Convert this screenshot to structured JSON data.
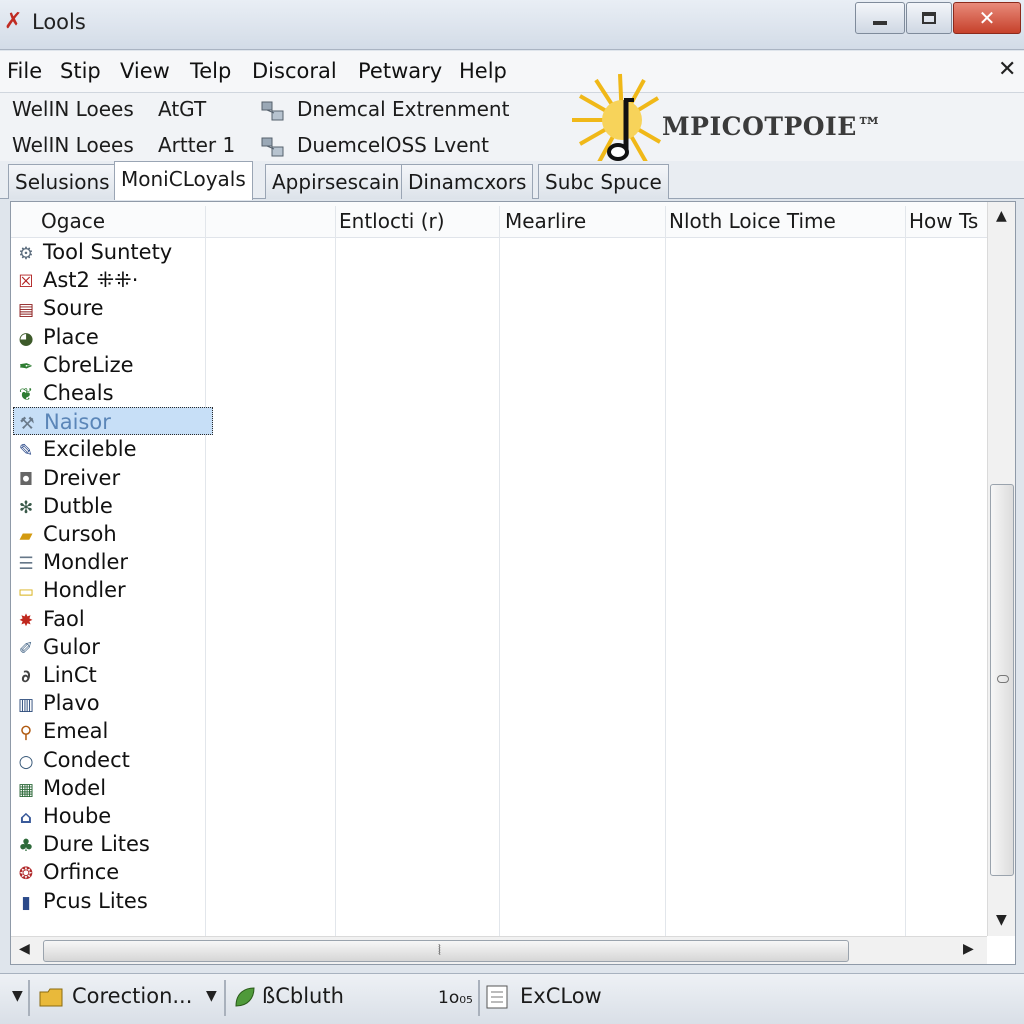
{
  "window": {
    "title": "Lools"
  },
  "menu": [
    "File",
    "Stip",
    "View",
    "Telp",
    "Discoral",
    "Petwary",
    "Help"
  ],
  "toolbar": {
    "row1": {
      "label": "WelIN Loees",
      "value": "AtGT",
      "button": "Dnemcal Extrenment"
    },
    "row2": {
      "label": "WelIN Loees",
      "value": "Artter 1",
      "button": "DuemcelOSS Lvent"
    }
  },
  "logo": {
    "text": "MPICOTPOIE™"
  },
  "tabs": [
    {
      "label": "Selusions",
      "active": false
    },
    {
      "label": "MoniCLoyals",
      "active": true
    },
    {
      "label": "Appirsescain",
      "active": false
    },
    {
      "label": "Dinamcxors",
      "active": false
    },
    {
      "label": "Subc Spuce",
      "active": false
    }
  ],
  "columns": [
    "Ogace",
    "Entlocti (r)",
    "Mearlire",
    "Nloth Loice Time",
    "How Ts"
  ],
  "rows": [
    {
      "label": "Tool Suntety",
      "icon": "gear-icon",
      "color": "#5a6b7c"
    },
    {
      "label": "Ast2 ⁜⁜·",
      "icon": "checkbox-icon",
      "color": "#b22222"
    },
    {
      "label": "Soure",
      "icon": "document-icon",
      "color": "#8b1a1a"
    },
    {
      "label": "Place",
      "icon": "globe-icon",
      "color": "#3d5a2a"
    },
    {
      "label": "CbreLize",
      "icon": "pen-icon",
      "color": "#2e7d32"
    },
    {
      "label": "Cheals",
      "icon": "leaf-icon",
      "color": "#2e7d32"
    },
    {
      "label": "Naisor",
      "icon": "tools-icon",
      "color": "#6a7a8a",
      "selected": true
    },
    {
      "label": "Excileble",
      "icon": "pencil-icon",
      "color": "#2b4a8a"
    },
    {
      "label": "Dreiver",
      "icon": "drive-icon",
      "color": "#666666"
    },
    {
      "label": "Dutble",
      "icon": "snowflake-icon",
      "color": "#3a5a4a"
    },
    {
      "label": "Cursoh",
      "icon": "folder-icon",
      "color": "#d39a10"
    },
    {
      "label": "Mondler",
      "icon": "list-icon",
      "color": "#667788"
    },
    {
      "label": "Hondler",
      "icon": "note-icon",
      "color": "#d8b21c"
    },
    {
      "label": "Faol",
      "icon": "bug-icon",
      "color": "#c0281e"
    },
    {
      "label": "Gulor",
      "icon": "paint-icon",
      "color": "#4a6a8a"
    },
    {
      "label": "LinCt",
      "icon": "link-icon",
      "color": "#444444"
    },
    {
      "label": "Plavo",
      "icon": "chart-icon",
      "color": "#2b4a7a"
    },
    {
      "label": "Emeal",
      "icon": "magnifier-icon",
      "color": "#b05a10"
    },
    {
      "label": "Condect",
      "icon": "search-icon",
      "color": "#3a5a7a"
    },
    {
      "label": "Model",
      "icon": "grid-icon",
      "color": "#2e6a3a"
    },
    {
      "label": "Hoube",
      "icon": "house-icon",
      "color": "#3a5a9a"
    },
    {
      "label": "Dure Lites",
      "icon": "lamp-icon",
      "color": "#2e6a3a"
    },
    {
      "label": "Orfince",
      "icon": "flame-icon",
      "color": "#b0282a"
    },
    {
      "label": "Pcus Lites",
      "icon": "bars-icon",
      "color": "#2b4a8a"
    }
  ],
  "statusbar": {
    "section1": "Corection...",
    "section2": "ßCbluth",
    "zoom": "1o₀₅",
    "section3": "ExCLow"
  }
}
